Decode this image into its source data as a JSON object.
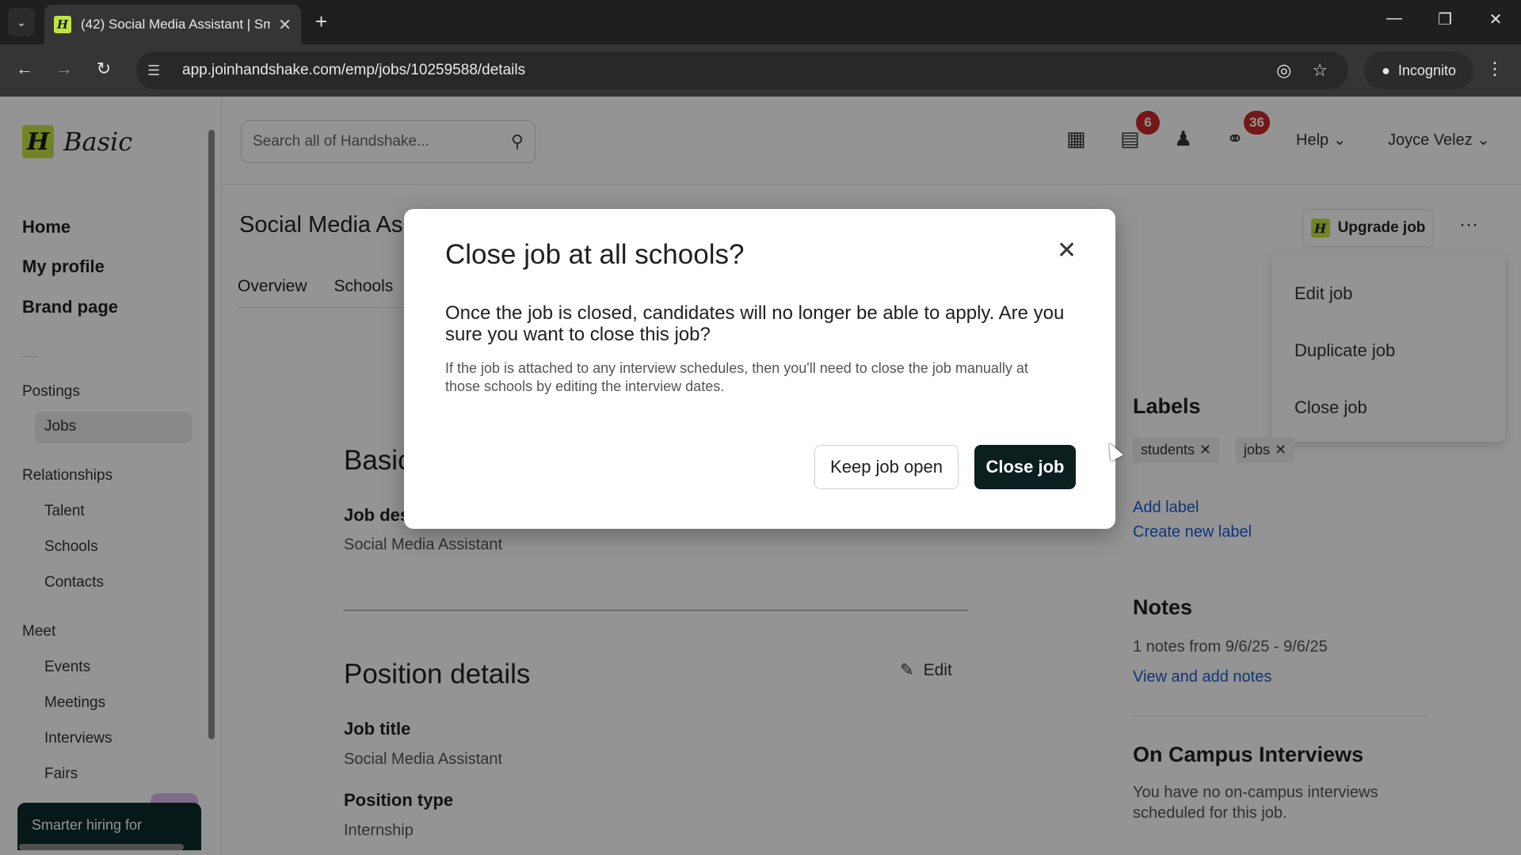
{
  "browser": {
    "tab_title": "(42) Social Media Assistant | Sm",
    "favicon_letter": "H",
    "url": "app.joinhandshake.com/emp/jobs/10259588/details",
    "incognito_label": "Incognito"
  },
  "brand": {
    "mark": "H",
    "plan": "Basic"
  },
  "sidebar": {
    "main": [
      "Home",
      "My profile",
      "Brand page"
    ],
    "postings_heading": "Postings",
    "postings_items": [
      "Jobs"
    ],
    "relationships_heading": "Relationships",
    "relationships_items": [
      "Talent",
      "Schools",
      "Contacts"
    ],
    "meet_heading": "Meet",
    "meet_items": [
      "Events",
      "Meetings",
      "Interviews",
      "Fairs"
    ],
    "promo_text": "Smarter hiring for"
  },
  "topbar": {
    "search_placeholder": "Search all of Handshake...",
    "messages_badge": "6",
    "network_badge": "36",
    "help_label": "Help",
    "user_name": "Joyce Velez"
  },
  "page": {
    "title": "Social Media As",
    "tabs": [
      "Overview",
      "Schools"
    ],
    "upgrade_label": "Upgrade job",
    "upgrade_mark": "H",
    "more_label": "···"
  },
  "actions_menu": [
    "Edit job",
    "Duplicate job",
    "Close job"
  ],
  "content": {
    "basic_heading": "Basic",
    "job_desc_label": "Job des",
    "job_desc_value": "Social Media Assistant",
    "position_heading": "Position details",
    "edit_label": "Edit",
    "job_title_label": "Job title",
    "job_title_value": "Social Media Assistant",
    "position_type_label": "Position type",
    "position_type_value": "Internship"
  },
  "right_panel": {
    "labels_heading": "Labels",
    "labels": [
      "students",
      "jobs"
    ],
    "add_label": "Add label",
    "create_label": "Create new label",
    "notes_heading": "Notes",
    "notes_summary": "1 notes from 9/6/25 - 9/6/25",
    "notes_link": "View and add notes",
    "interviews_heading": "On Campus Interviews",
    "interviews_text": "You have no on-campus interviews scheduled for this job."
  },
  "modal": {
    "title": "Close job at all schools?",
    "body": "Once the job is closed, candidates will no longer be able to apply. Are you sure you want to close this job?",
    "note": "If the job is attached to any interview schedules, then you'll need to close the job manually at those schools by editing the interview dates.",
    "keep_label": "Keep job open",
    "close_label": "Close job"
  },
  "colors": {
    "brand_lime": "#c5e340",
    "primary_dark": "#0b1f1f",
    "badge_red": "#c62828",
    "link_blue": "#1a5ccc"
  }
}
